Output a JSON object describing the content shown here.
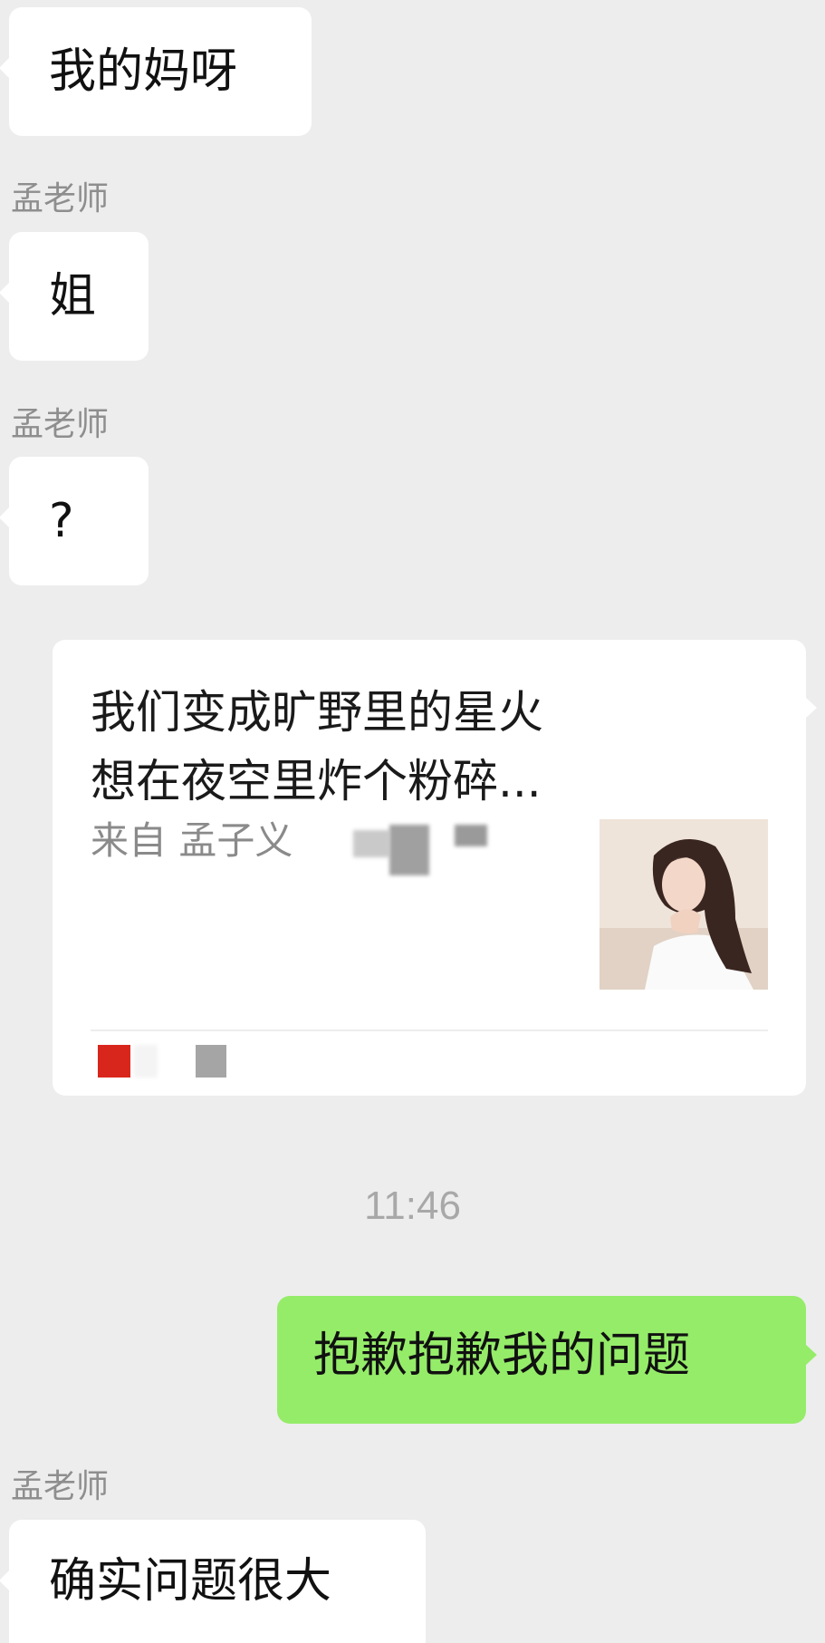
{
  "messages": [
    {
      "type": "incoming",
      "sender": "",
      "text": "我的妈呀"
    },
    {
      "type": "incoming",
      "sender": "孟老师",
      "text": "姐"
    },
    {
      "type": "incoming",
      "sender": "孟老师",
      "text": "?"
    },
    {
      "type": "shared_card",
      "title_lines": [
        "我们变成旷野里的星火",
        "想在夜空里炸个粉碎..."
      ],
      "source": "来自 孟子义"
    },
    {
      "type": "timestamp",
      "text": "11:46"
    },
    {
      "type": "outgoing",
      "text": "抱歉抱歉我的问题"
    },
    {
      "type": "incoming",
      "sender": "孟老师",
      "text": "确实问题很大"
    }
  ],
  "colors": {
    "background": "#ededed",
    "incoming_bubble": "#ffffff",
    "outgoing_bubble": "#95ec69",
    "sender_name": "#8e8e8e",
    "timestamp": "#a8a8a8"
  }
}
